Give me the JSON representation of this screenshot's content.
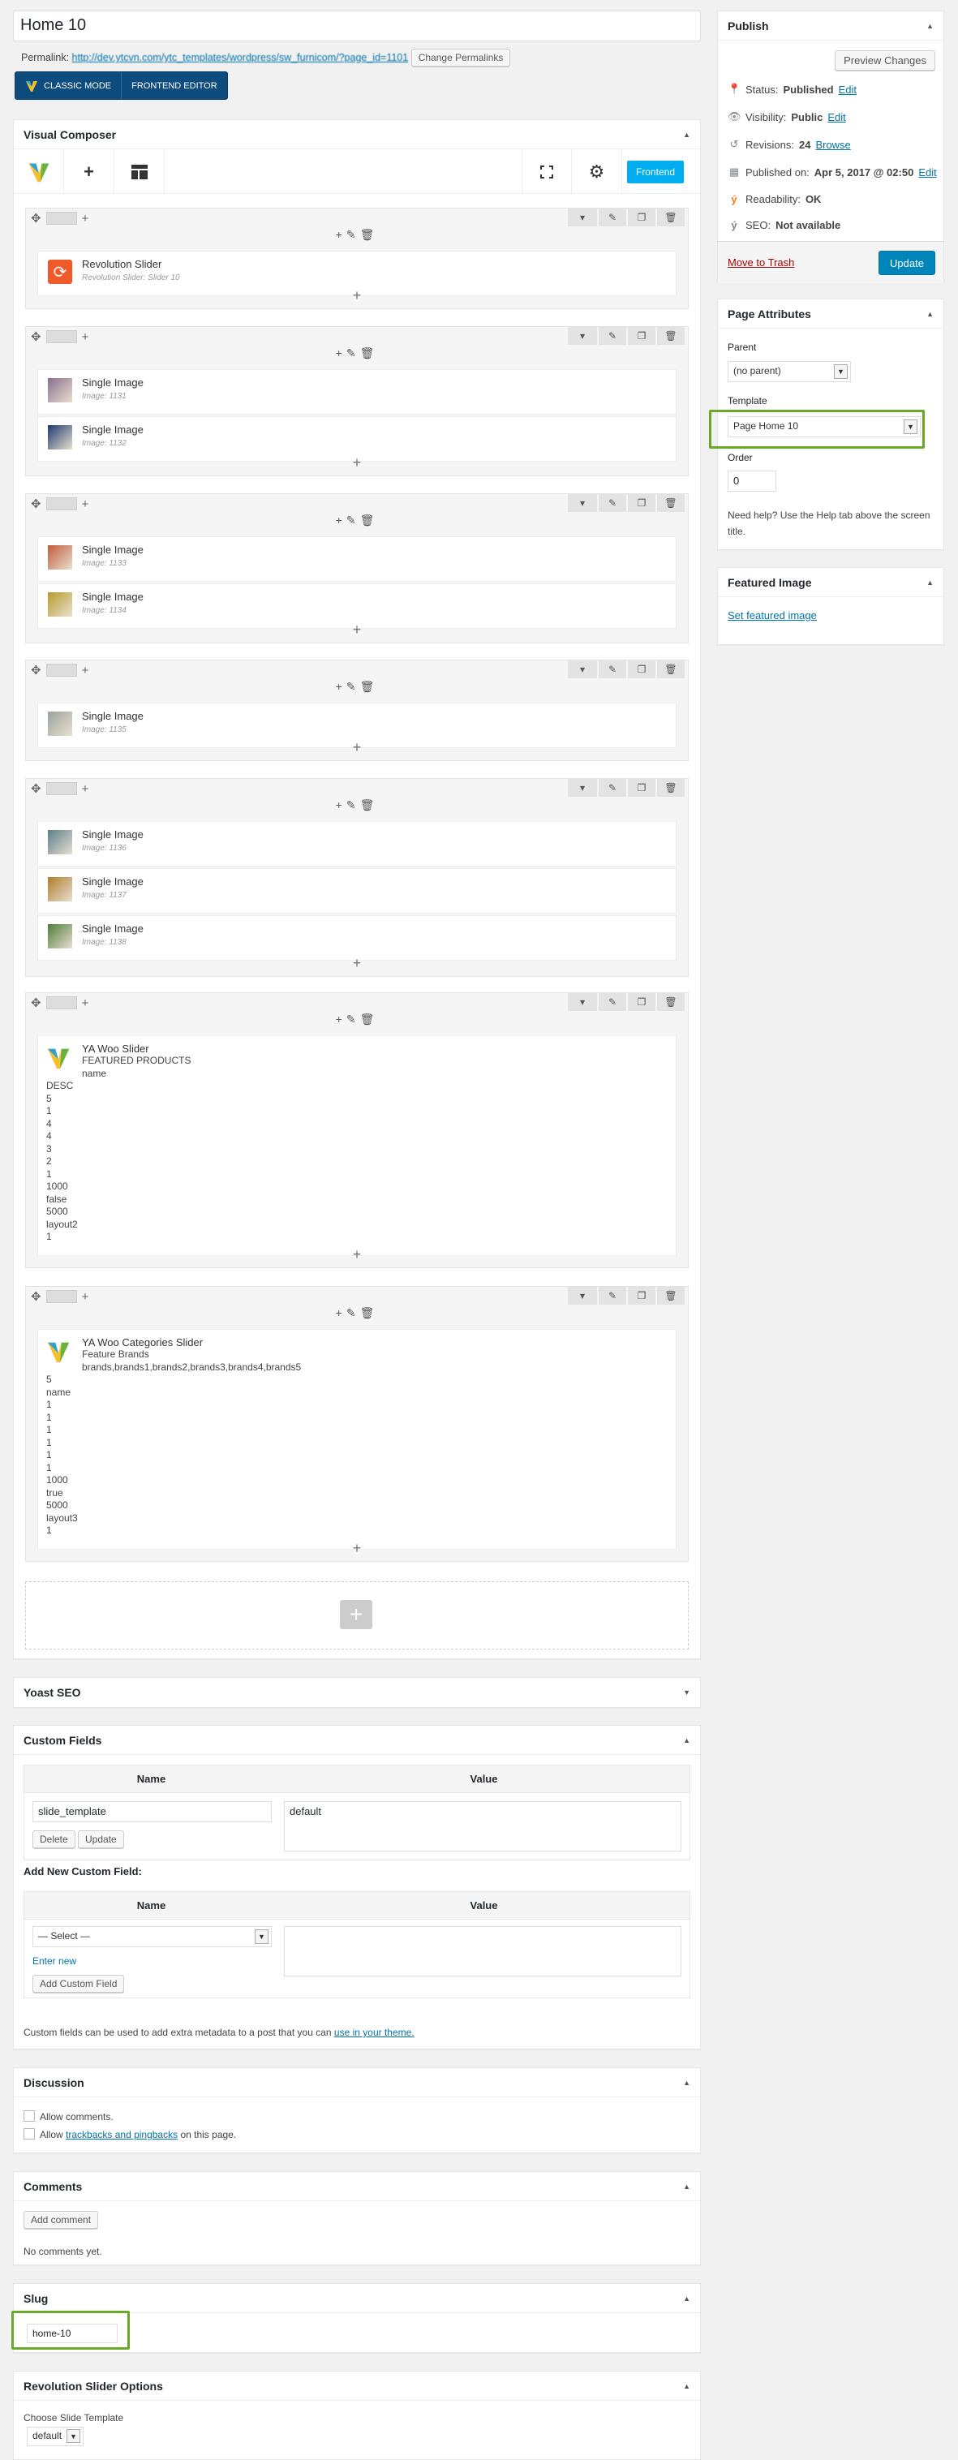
{
  "title": "Home 10",
  "permalink": {
    "label": "Permalink:",
    "url": "http://dev.ytcvn.com/ytc_templates/wordpress/sw_furnicom/?page_id=1101",
    "button": "Change Permalinks"
  },
  "modes": {
    "classic": "CLASSIC MODE",
    "frontend": "FRONTEND EDITOR"
  },
  "vc": {
    "title": "Visual Composer",
    "frontend_btn": "Frontend",
    "rows": [
      {
        "elements": [
          {
            "name": "Revolution Slider",
            "sub": "Revolution Slider: Slider 10",
            "icon": "revolution-slider-icon",
            "color": "#f0592a"
          }
        ]
      },
      {
        "elements": [
          {
            "name": "Single Image",
            "sub": "Image: 1131",
            "icon": "image-thumb",
            "color": "#8b6f8c"
          },
          {
            "name": "Single Image",
            "sub": "Image: 1132",
            "icon": "image-thumb",
            "color": "#1c3a6e"
          }
        ]
      },
      {
        "elements": [
          {
            "name": "Single Image",
            "sub": "Image: 1133",
            "icon": "image-thumb",
            "color": "#c25b3a"
          },
          {
            "name": "Single Image",
            "sub": "Image: 1134",
            "icon": "image-thumb",
            "color": "#b89b2a"
          }
        ]
      },
      {
        "elements": [
          {
            "name": "Single Image",
            "sub": "Image: 1135",
            "icon": "image-thumb",
            "color": "#9aa39a"
          }
        ]
      },
      {
        "elements": [
          {
            "name": "Single Image",
            "sub": "Image: 1136",
            "icon": "image-thumb",
            "color": "#5b7f8a"
          },
          {
            "name": "Single Image",
            "sub": "Image: 1137",
            "icon": "image-thumb",
            "color": "#b27c2c"
          },
          {
            "name": "Single Image",
            "sub": "Image: 1138",
            "icon": "image-thumb",
            "color": "#4f7d3a"
          }
        ]
      },
      {
        "elements": [
          {
            "name": "YA Woo Slider",
            "lines1": "FEATURED PRODUCTS\nname",
            "lines2": "DESC\n5\n1\n4\n4\n3\n2\n1\n1000\nfalse\n5000\nlayout2\n1",
            "icon": "vc-logo-icon"
          }
        ]
      },
      {
        "elements": [
          {
            "name": "YA Woo Categories Slider",
            "lines1": "Feature Brands\nbrands,brands1,brands2,brands3,brands4,brands5",
            "lines2": "5\nname\n1\n1\n1\n1\n1\n1\n1000\ntrue\n5000\nlayout3\n1",
            "icon": "vc-logo-icon"
          }
        ]
      }
    ]
  },
  "yoast": {
    "title": "Yoast SEO"
  },
  "custom_fields": {
    "title": "Custom Fields",
    "col_name": "Name",
    "col_value": "Value",
    "field_name": "slide_template",
    "field_value": "default",
    "delete": "Delete",
    "update": "Update",
    "add_new": "Add New Custom Field:",
    "select": "— Select —",
    "enter_new": "Enter new",
    "add_btn": "Add Custom Field",
    "note": "Custom fields can be used to add extra metadata to a post that you can",
    "note_link": "use in your theme."
  },
  "discussion": {
    "title": "Discussion",
    "allow_comments": "Allow comments.",
    "allow_prefix": "Allow",
    "trackbacks": "trackbacks and pingbacks",
    "allow_suffix": "on this page."
  },
  "comments": {
    "title": "Comments",
    "add": "Add comment",
    "none": "No comments yet."
  },
  "slug": {
    "title": "Slug",
    "value": "home-10"
  },
  "revslider": {
    "title": "Revolution Slider Options",
    "label": "Choose Slide Template",
    "value": "default"
  },
  "publish": {
    "title": "Publish",
    "preview": "Preview Changes",
    "status_label": "Status:",
    "status": "Published",
    "visibility_label": "Visibility:",
    "visibility": "Public",
    "revisions_label": "Revisions:",
    "revisions": "24",
    "browse": "Browse",
    "published_label": "Published on:",
    "published": "Apr 5, 2017 @ 02:50",
    "readability_label": "Readability:",
    "readability": "OK",
    "seo_label": "SEO:",
    "seo": "Not available",
    "edit": "Edit",
    "trash": "Move to Trash",
    "update": "Update"
  },
  "attributes": {
    "title": "Page Attributes",
    "parent_label": "Parent",
    "parent": "(no parent)",
    "template_label": "Template",
    "template": "Page Home 10",
    "order_label": "Order",
    "order": "0",
    "help": "Need help? Use the Help tab above the screen title."
  },
  "featured": {
    "title": "Featured Image",
    "link": "Set featured image"
  },
  "colors": {
    "accent": "#0073aa",
    "highlight": "#6aa829",
    "frontend": "#00aef0"
  }
}
